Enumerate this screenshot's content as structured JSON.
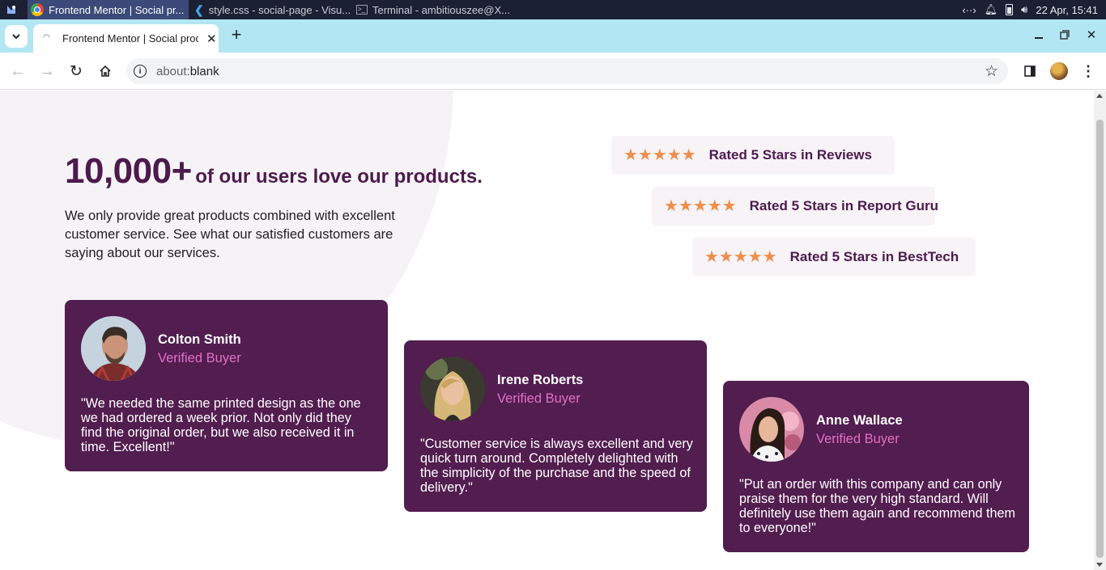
{
  "taskbar": {
    "windows": [
      {
        "label": "Frontend Mentor | Social pr...",
        "active": true
      },
      {
        "label": "style.css - social-page - Visu...",
        "active": false
      },
      {
        "label": "Terminal - ambitiouszee@X...",
        "active": false
      }
    ],
    "datetime": "22 Apr, 15:41"
  },
  "browser": {
    "tab_title": "Frontend Mentor | Social proo",
    "url_scheme": "about:",
    "url_rest": "blank"
  },
  "page": {
    "headline_number": "10,000+",
    "headline_rest": "of our users love our products.",
    "intro": "We only provide great products combined with excellent customer service. See what our satisfied customers are saying about our services.",
    "ratings": [
      {
        "label": "Rated 5 Stars in Reviews",
        "stars": 5
      },
      {
        "label": "Rated 5 Stars in Report Guru",
        "stars": 5
      },
      {
        "label": "Rated 5 Stars in BestTech",
        "stars": 5
      }
    ],
    "testimonials": [
      {
        "name": "Colton Smith",
        "status": "Verified Buyer",
        "quote": "\"We needed the same printed design as the one we had ordered a week prior. Not only did they find the original order, but we also received it in time. Excellent!\""
      },
      {
        "name": "Irene Roberts",
        "status": "Verified Buyer",
        "quote": "\"Customer service is always excellent and very quick turn around. Completely delighted with the simplicity of the purchase and the speed of delivery.\""
      },
      {
        "name": "Anne Wallace",
        "status": "Verified Buyer",
        "quote": "\"Put an order with this company and can only praise them for the very high standard. Will definitely use them again and recommend them to everyone!\""
      }
    ]
  },
  "colors": {
    "accent_dark": "#4d1a4d",
    "card_bg": "#521d4f",
    "star": "#ee8e4b",
    "verified": "#e270c7",
    "tabstrip": "#b2e6f2"
  }
}
